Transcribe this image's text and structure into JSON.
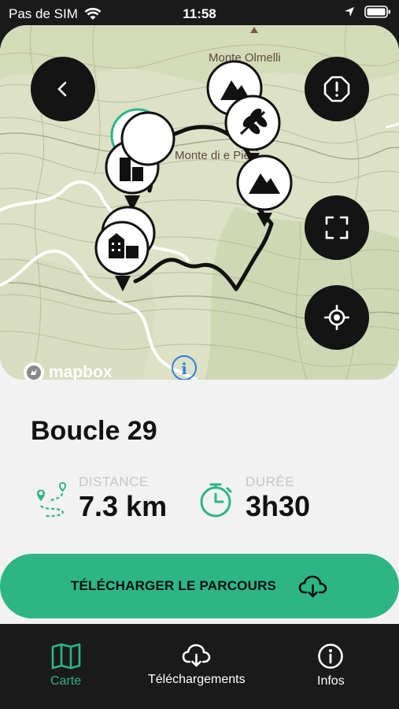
{
  "status_bar": {
    "carrier": "Pas de SIM",
    "time": "11:58"
  },
  "map": {
    "labels": {
      "peak1": "Monte Olmelli",
      "peak2": "Monte di e Pievi"
    },
    "attribution": "mapbox",
    "info_label": "i"
  },
  "route": {
    "title": "Boucle 29",
    "distance_label": "DISTANCE",
    "distance_value": "7.3 km",
    "duration_label": "DURÉE",
    "duration_value": "3h30"
  },
  "download_button": {
    "label": "TÉLÉCHARGER LE PARCOURS"
  },
  "tabs": [
    {
      "label": "Carte",
      "active": true
    },
    {
      "label": "Téléchargements",
      "active": false
    },
    {
      "label": "Infos",
      "active": false
    }
  ],
  "colors": {
    "accent": "#2db586",
    "active_tab": "#2db586",
    "dark": "#141414",
    "sheet": "#f2f2f2"
  }
}
